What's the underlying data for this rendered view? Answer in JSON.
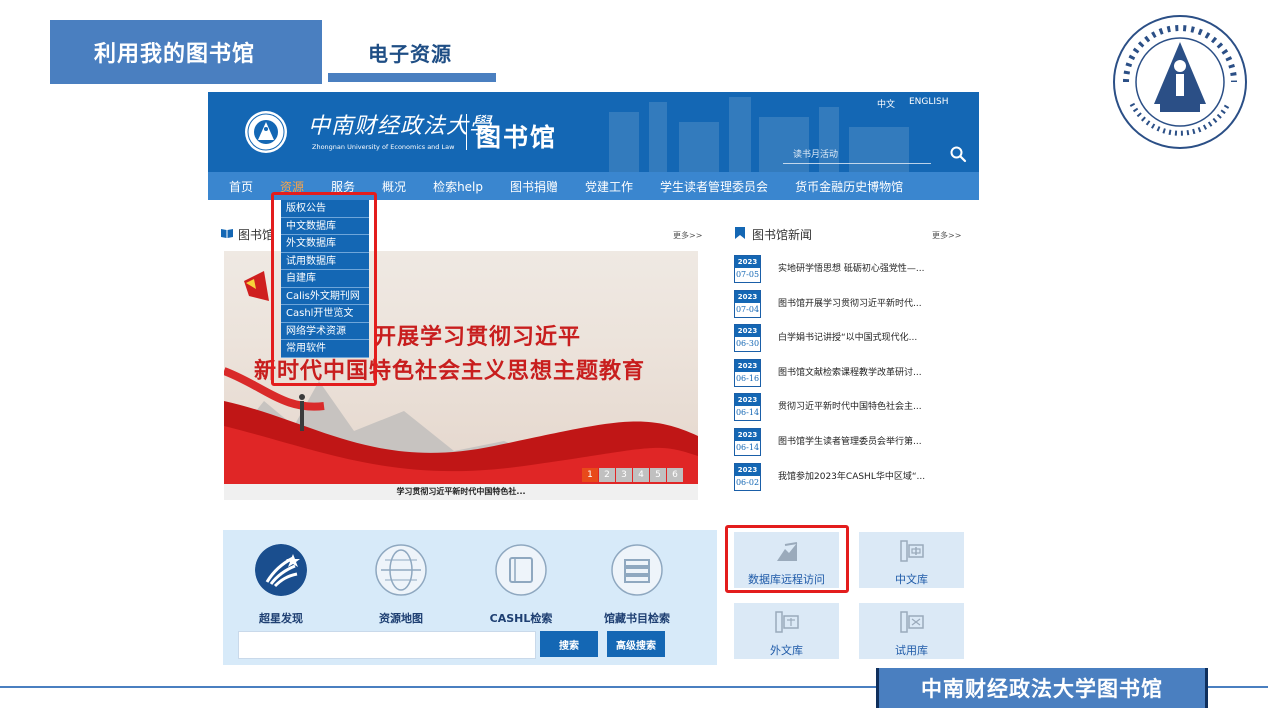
{
  "slide": {
    "tab_active": "利用我的图书馆",
    "tab_2": "电子资源",
    "footer": "中南财经政法大学图书馆"
  },
  "site": {
    "header": {
      "logo_cn": "中南财经政法大學",
      "logo_en": "Zhongnan University of Economics and Law",
      "logo_lib": "图书馆",
      "lang_cn": "中文",
      "lang_en": "ENGLISH",
      "search_placeholder": "读书月活动"
    },
    "nav": [
      "首页",
      "资源",
      "服务",
      "概况",
      "检索help",
      "图书捐赠",
      "党建工作",
      "学生读者管理委员会",
      "货币金融历史博物馆"
    ],
    "dropdown": [
      "版权公告",
      "中文数据库",
      "外文数据库",
      "试用数据库",
      "自建库",
      "Calis外文期刊网",
      "Cashl开世览文",
      "网络学术资源",
      "常用软件"
    ],
    "left_section": {
      "title": "图书馆",
      "more": "更多>>"
    },
    "banner": {
      "line1": "开展学习贯彻习近平",
      "line2": "新时代中国特色社会主义思想主题教育",
      "caption": "学习贯彻习近平新时代中国特色社...",
      "pages": [
        "1",
        "2",
        "3",
        "4",
        "5",
        "6"
      ]
    },
    "news": {
      "title": "图书馆新闻",
      "more": "更多>>",
      "items": [
        {
          "year": "2023",
          "md": "07-05",
          "title": "实地研学悟思想 砥砺初心强党性—..."
        },
        {
          "year": "2023",
          "md": "07-04",
          "title": "图书馆开展学习贯彻习近平新时代..."
        },
        {
          "year": "2023",
          "md": "06-30",
          "title": "白学娟书记讲授“以中国式现代化..."
        },
        {
          "year": "2023",
          "md": "06-16",
          "title": "图书馆文献检索课程教学改革研讨..."
        },
        {
          "year": "2023",
          "md": "06-14",
          "title": "贯彻习近平新时代中国特色社会主..."
        },
        {
          "year": "2023",
          "md": "06-14",
          "title": "图书馆学生读者管理委员会举行第..."
        },
        {
          "year": "2023",
          "md": "06-02",
          "title": "我馆参加2023年CASHL华中区域“..."
        }
      ]
    },
    "tools": {
      "items": [
        "超星发现",
        "资源地图",
        "CASHL检索",
        "馆藏书目检索"
      ],
      "search_btn": "搜索",
      "advanced_btn": "高级搜索"
    },
    "db_tiles": [
      "数据库远程访问",
      "中文库",
      "外文库",
      "试用库"
    ],
    "colors": {
      "primary": "#1467b4",
      "nav": "#3a86cf",
      "accent": "#e31d1d",
      "active_nav": "#f7a34a"
    }
  }
}
